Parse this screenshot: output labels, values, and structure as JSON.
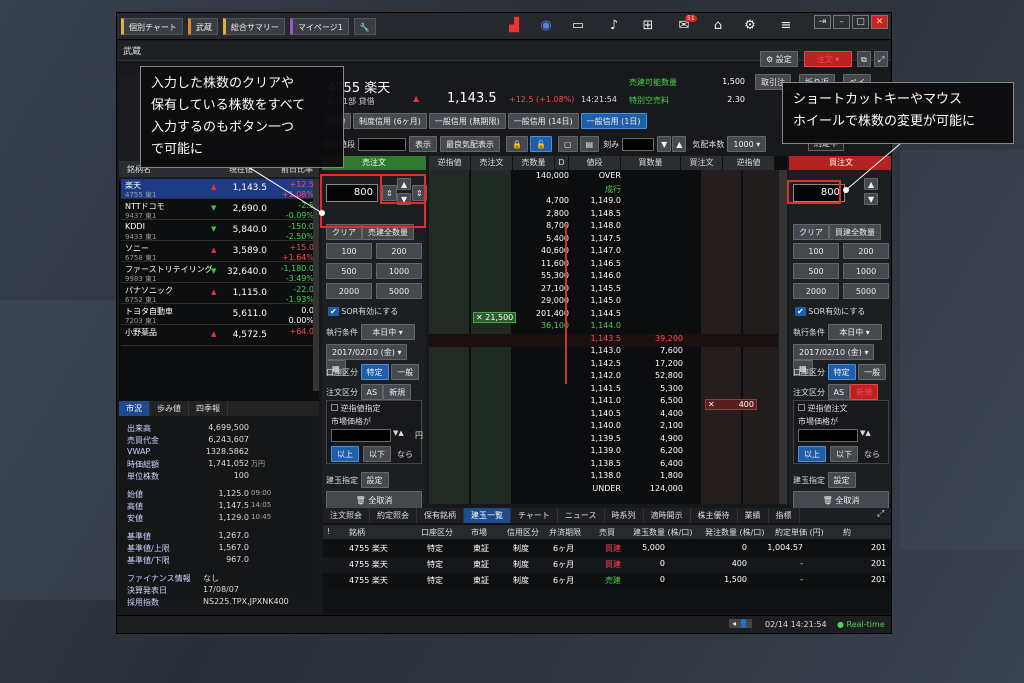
{
  "toolbar": {
    "chips": [
      "個別チャート",
      "武蔵",
      "総合サマリー",
      "マイページ1"
    ],
    "badge_count": "51"
  },
  "window": {
    "title": "武蔵",
    "settings": "設定",
    "order": "注文"
  },
  "stock": {
    "code_name": "4755 楽天",
    "market": "東証1部 貸借",
    "price": "1,143.5",
    "change": "+12.5 (+1.08%)",
    "time": "14:21:54",
    "sellable_label": "売建可能数量",
    "sellable": "1,500",
    "special_label": "特別空売料",
    "special": "2.30",
    "pill1": "取引注",
    "pill2": "折り返",
    "pill3": "ペイ"
  },
  "order_tabs": [
    "現物",
    "制度信用 (6ヶ月)",
    "一般信用 (無期限)",
    "一般信用 (14日)",
    "一般信用 (1日)"
  ],
  "ctrl": {
    "mid": "中心値段",
    "show": "表示",
    "best": "最良気配表示",
    "step": "刻み",
    "quote": "気配本数",
    "quote_val": "1000"
  },
  "watchlist": {
    "header_name": "銘柄名",
    "header_price": "現在値",
    "header_pct": "前日比率",
    "rows": [
      {
        "name": "楽天",
        "code": "4755 東1",
        "price": "1,143.5",
        "arrow": "▲",
        "chg": "+12.5",
        "pct": "+1.08%",
        "up": true
      },
      {
        "name": "NTTドコモ",
        "code": "9437 東1",
        "price": "2,690.0",
        "arrow": "▼",
        "chg": "-2.5",
        "pct": "-0.09%",
        "up": false
      },
      {
        "name": "KDDI",
        "code": "9433 東1",
        "price": "5,840.0",
        "arrow": "▼",
        "chg": "-150.0",
        "pct": "-2.50%",
        "up": false
      },
      {
        "name": "ソニー",
        "code": "6758 東1",
        "price": "3,589.0",
        "arrow": "▲",
        "chg": "+15.0",
        "pct": "+1.64%",
        "up": true
      },
      {
        "name": "ファーストリテイリング",
        "code": "9983 東1",
        "price": "32,640.0",
        "arrow": "▼",
        "chg": "-1,180.0",
        "pct": "-3.49%",
        "up": false
      },
      {
        "name": "パナソニック",
        "code": "6752 東1",
        "price": "1,115.0",
        "arrow": "▲",
        "chg": "-22.0",
        "pct": "-1.93%",
        "up": false
      },
      {
        "name": "トヨタ自動車",
        "code": "7203 東1",
        "price": "5,611.0",
        "arrow": "",
        "chg": "0.0",
        "pct": "0.00%",
        "up": true
      },
      {
        "name": "小野薬品",
        "code": "",
        "price": "4,572.5",
        "arrow": "▲",
        "chg": "+64.0",
        "pct": "",
        "up": true
      }
    ]
  },
  "market_tabs": [
    "市況",
    "歩み値",
    "四季報"
  ],
  "market": [
    {
      "l": "出来高",
      "v": "4,699,500",
      "u": ""
    },
    {
      "l": "売買代金",
      "v": "6,243,607",
      "u": ""
    },
    {
      "l": "VWAP",
      "v": "1328.5862",
      "u": ""
    },
    {
      "l": "時価総額",
      "v": "1,741,052",
      "u": "万円"
    },
    {
      "l": "単位株数",
      "v": "100",
      "u": ""
    },
    {
      "l": "始値",
      "v": "1,125.0",
      "u": "09:00"
    },
    {
      "l": "高値",
      "v": "1,147.5",
      "u": "14:05"
    },
    {
      "l": "安値",
      "v": "1,129.0",
      "u": "10:45"
    },
    {
      "l": "基準値",
      "v": "1,267.0",
      "u": ""
    },
    {
      "l": "基準値/上限",
      "v": "1,567.0",
      "u": ""
    },
    {
      "l": "基準値/下限",
      "v": "967.0",
      "u": ""
    },
    {
      "l": "ファイナンス情報",
      "v": "なし",
      "u": ""
    },
    {
      "l": "決算発表日",
      "v": "17/08/07",
      "u": ""
    },
    {
      "l": "採用指数",
      "v": "NS225.TPX,JPXNK400",
      "u": ""
    }
  ],
  "sell": {
    "title": "売注文",
    "qty": "800",
    "clear": "クリア",
    "all": "売建全数量",
    "q": [
      "100",
      "200",
      "500",
      "1000",
      "2000",
      "5000"
    ],
    "sor": "SOR有効にする",
    "cond_l": "執行条件",
    "cond": "本日中",
    "date": "2017/02/10 (金)",
    "acct_l": "口座区分",
    "acct1": "特定",
    "acct2": "一般",
    "type_l": "注文区分",
    "t1": "AS",
    "t2": "新規",
    "t3": "返済",
    "stop_l": "逆指値指定",
    "mkt_l": "市場価格が",
    "yen": "円",
    "ge": "以上",
    "le": "以下",
    "nara": "なら",
    "pos_l": "建玉指定",
    "set": "設定",
    "cancel": "全取消"
  },
  "buy": {
    "title": "買注文",
    "qty": "800",
    "clear": "クリア",
    "all": "買建全数量",
    "q": [
      "100",
      "200",
      "500",
      "1000",
      "2000",
      "5000"
    ],
    "sor": "SOR有効にする",
    "cond_l": "執行条件",
    "cond": "本日中",
    "date": "2017/02/10 (金)",
    "acct_l": "口座区分",
    "acct1": "特定",
    "acct2": "一般",
    "type_l": "注文区分",
    "t1": "AS",
    "t2": "新規",
    "t3": "返済",
    "stop_l": "逆指値注文",
    "mkt_l": "市場価格が",
    "ge": "以上",
    "le": "以下",
    "nara": "なら",
    "pos_l": "建玉指定",
    "set": "設定",
    "cancel": "全取消"
  },
  "board": {
    "headers": [
      "逆指値",
      "売注文",
      "売数量",
      "D",
      "値段",
      "買数量",
      "買注文",
      "逆指値"
    ],
    "sell_order": "21,500",
    "buy_order": "400",
    "rows": [
      {
        "sq": "140,000",
        "p": "OVER",
        "bq": ""
      },
      {
        "sq": "",
        "p": "成行",
        "bq": ""
      },
      {
        "sq": "4,700",
        "p": "1,149.0",
        "bq": ""
      },
      {
        "sq": "2,800",
        "p": "1,148.5",
        "bq": ""
      },
      {
        "sq": "8,700",
        "p": "1,148.0",
        "bq": ""
      },
      {
        "sq": "5,400",
        "p": "1,147.5",
        "bq": ""
      },
      {
        "sq": "40,600",
        "p": "1,147.0",
        "bq": ""
      },
      {
        "sq": "11,600",
        "p": "1,146.5",
        "bq": ""
      },
      {
        "sq": "55,300",
        "p": "1,146.0",
        "bq": ""
      },
      {
        "sq": "27,100",
        "p": "1,145.5",
        "bq": ""
      },
      {
        "sq": "29,000",
        "p": "1,145.0",
        "bq": ""
      },
      {
        "sq": "201,400",
        "p": "1,144.5",
        "bq": ""
      },
      {
        "sq": "36,100",
        "p": "1,144.0",
        "bq": ""
      },
      {
        "sq": "",
        "p": "1,143.5",
        "bq": "39,200"
      },
      {
        "sq": "",
        "p": "1,143.0",
        "bq": "7,600"
      },
      {
        "sq": "",
        "p": "1,142.5",
        "bq": "17,200"
      },
      {
        "sq": "",
        "p": "1,142.0",
        "bq": "52,800"
      },
      {
        "sq": "",
        "p": "1,141.5",
        "bq": "5,300"
      },
      {
        "sq": "",
        "p": "1,141.0",
        "bq": "6,500"
      },
      {
        "sq": "",
        "p": "1,140.5",
        "bq": "4,400"
      },
      {
        "sq": "",
        "p": "1,140.0",
        "bq": "2,100"
      },
      {
        "sq": "",
        "p": "1,139.5",
        "bq": "4,900"
      },
      {
        "sq": "",
        "p": "1,139.0",
        "bq": "6,200"
      },
      {
        "sq": "",
        "p": "1,138.5",
        "bq": "6,400"
      },
      {
        "sq": "",
        "p": "1,138.0",
        "bq": "1,800"
      },
      {
        "sq": "",
        "p": "UNDER",
        "bq": "124,000"
      }
    ]
  },
  "bottom_tabs": [
    "注文照会",
    "約定照会",
    "保有銘柄",
    "建玉一覧",
    "チャート",
    "ニュース",
    "時系列",
    "適時開示",
    "株主優待",
    "業績",
    "指標"
  ],
  "pos_headers": [
    "!",
    "銘柄",
    "口座区分",
    "市場",
    "信用区分",
    "弁済期限",
    "売買",
    "建玉数量 (株/口)",
    "発注数量 (株/口)",
    "約定単価 (円)",
    "約"
  ],
  "positions": [
    {
      "n": "4755 楽天",
      "a": "特定",
      "m": "東証",
      "c": "制度",
      "t": "6ヶ月",
      "s": "買建",
      "q": "5,000",
      "o": "0",
      "p": "1,004.57",
      "d": "201"
    },
    {
      "n": "4755 楽天",
      "a": "特定",
      "m": "東証",
      "c": "制度",
      "t": "6ヶ月",
      "s": "買建",
      "q": "0",
      "o": "400",
      "p": "-",
      "d": "201"
    },
    {
      "n": "4755 楽天",
      "a": "特定",
      "m": "東証",
      "c": "制度",
      "t": "6ヶ月",
      "s": "売建",
      "q": "0",
      "o": "1,500",
      "p": "-",
      "d": "201"
    }
  ],
  "status": {
    "time": "02/14 14:21:54",
    "rt": "Real-time"
  },
  "callouts": {
    "left": [
      "入力した株数のクリアや",
      "保有している株数をすべて",
      "入力するのもボタン一つ",
      "で可能に"
    ],
    "right": [
      "ショートカットキーやマウス",
      "ホイールで株数の変更が可能に"
    ]
  },
  "misc": {
    "extra1": "7",
    "extra2": "8",
    "extra3": "9",
    "extra4": "10",
    "buy_yakujou": "約定中"
  }
}
